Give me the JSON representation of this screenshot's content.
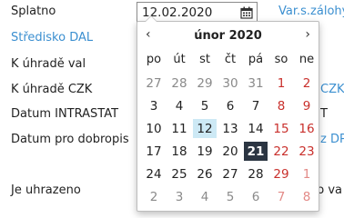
{
  "form": {
    "splatno_label": "Splatno",
    "date_value": "12.02.2020",
    "link_var_zalohy": "Var.s.zálohy",
    "stredisko_label": "Středisko DAL",
    "k_uhrade_val_label": "K úhradě val",
    "k_uhrade_czk_label": "K úhradě CZK",
    "czk_partial": "CZK",
    "datum_intrastat_label": "Datum INTRASTAT",
    "intrastat_partial": "T",
    "datum_dobropis_label": "Datum pro dobropis",
    "dobropis_partial": "z DP",
    "je_uhrazeno_label": "Je uhrazeno",
    "uhrazeno_partial": "no va"
  },
  "calendar": {
    "prev_label": "‹",
    "next_label": "›",
    "month_title": "únor 2020",
    "weekdays": [
      "po",
      "út",
      "st",
      "čt",
      "pá",
      "so",
      "ne"
    ],
    "selected_day": "12",
    "today_day": "21",
    "weeks": [
      [
        "27",
        "28",
        "29",
        "30",
        "31",
        "1",
        "2"
      ],
      [
        "3",
        "4",
        "5",
        "6",
        "7",
        "8",
        "9"
      ],
      [
        "10",
        "11",
        "12",
        "13",
        "14",
        "15",
        "16"
      ],
      [
        "17",
        "18",
        "19",
        "20",
        "21",
        "22",
        "23"
      ],
      [
        "24",
        "25",
        "26",
        "27",
        "28",
        "29",
        "1"
      ],
      [
        "2",
        "3",
        "4",
        "5",
        "6",
        "7",
        "8"
      ]
    ],
    "other_month_cells": [
      [
        0,
        0
      ],
      [
        0,
        1
      ],
      [
        0,
        2
      ],
      [
        0,
        3
      ],
      [
        0,
        4
      ],
      [
        4,
        6
      ],
      [
        5,
        0
      ],
      [
        5,
        1
      ],
      [
        5,
        2
      ],
      [
        5,
        3
      ],
      [
        5,
        4
      ],
      [
        5,
        5
      ],
      [
        5,
        6
      ]
    ]
  },
  "colors": {
    "link": "#3b8fd0",
    "weekend": "#c9302c",
    "selected_bg": "#cde9f5",
    "today_bg": "#2b3542"
  }
}
